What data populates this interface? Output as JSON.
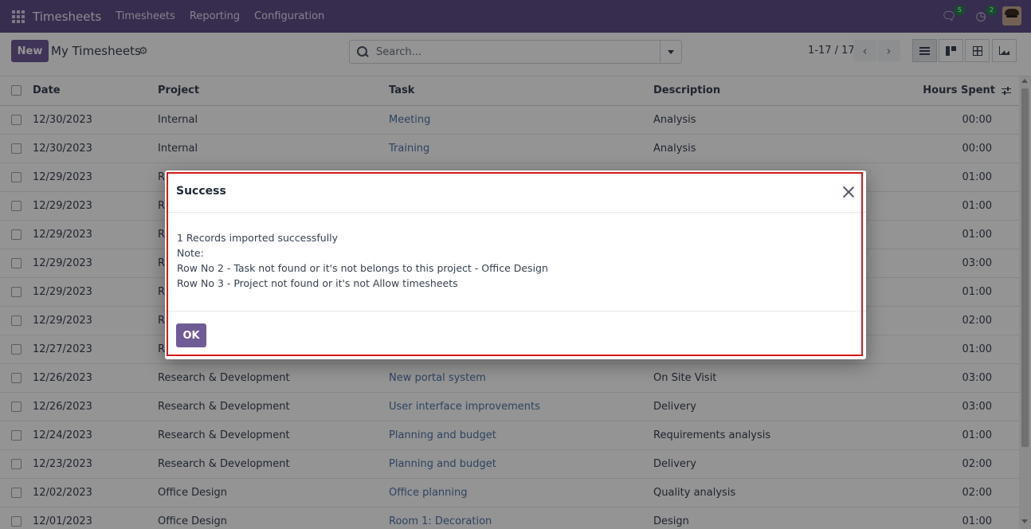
{
  "navbar": {
    "app_name": "Timesheets",
    "menu": [
      "Timesheets",
      "Reporting",
      "Configuration"
    ],
    "messages_count": "5",
    "activities_count": "2"
  },
  "control": {
    "new_label": "New",
    "title": "My Timesheets",
    "search_placeholder": "Search...",
    "pager": "1-17 / 17"
  },
  "table": {
    "headers": [
      "Date",
      "Project",
      "Task",
      "Description",
      "Hours Spent"
    ],
    "rows": [
      [
        "12/30/2023",
        "Internal",
        "Meeting",
        "Analysis",
        "00:00"
      ],
      [
        "12/30/2023",
        "Internal",
        "Training",
        "Analysis",
        "00:00"
      ],
      [
        "12/29/2023",
        "R",
        "",
        "",
        "01:00"
      ],
      [
        "12/29/2023",
        "R",
        "",
        "",
        "01:00"
      ],
      [
        "12/29/2023",
        "R",
        "",
        "",
        "01:00"
      ],
      [
        "12/29/2023",
        "R",
        "",
        "",
        "03:00"
      ],
      [
        "12/29/2023",
        "R",
        "",
        "",
        "01:00"
      ],
      [
        "12/29/2023",
        "R",
        "",
        "",
        "02:00"
      ],
      [
        "12/27/2023",
        "R",
        "",
        "",
        "01:00"
      ],
      [
        "12/26/2023",
        "Research & Development",
        "New portal system",
        "On Site Visit",
        "03:00"
      ],
      [
        "12/26/2023",
        "Research & Development",
        "User interface improvements",
        "Delivery",
        "03:00"
      ],
      [
        "12/24/2023",
        "Research & Development",
        "Planning and budget",
        "Requirements analysis",
        "01:00"
      ],
      [
        "12/23/2023",
        "Research & Development",
        "Planning and budget",
        "Delivery",
        "02:00"
      ],
      [
        "12/02/2023",
        "Office Design",
        "Office planning",
        "Quality analysis",
        "02:00"
      ],
      [
        "12/01/2023",
        "Office Design",
        "Room 1: Decoration",
        "Design",
        "01:00"
      ]
    ]
  },
  "modal": {
    "title": "Success",
    "lines": [
      "1 Records imported successfully",
      "Note:",
      "Row No 2  - Task not found or it's not belongs to this project - Office Design",
      "Row No 3  - Project not found or it's not Allow timesheets"
    ],
    "ok_label": "OK"
  },
  "colors": {
    "navbar": "#5f4f88",
    "primary_button": "#6f5b98",
    "link": "#4f74a7",
    "highlight_border": "#d41919"
  },
  "icons": [
    "apps-grid-icon",
    "chat-icon",
    "clock-icon",
    "gear-icon",
    "search-icon",
    "chevron-left-icon",
    "chevron-right-icon",
    "list-view-icon",
    "kanban-view-icon",
    "pivot-view-icon",
    "graph-view-icon",
    "column-settings-icon",
    "close-icon"
  ]
}
